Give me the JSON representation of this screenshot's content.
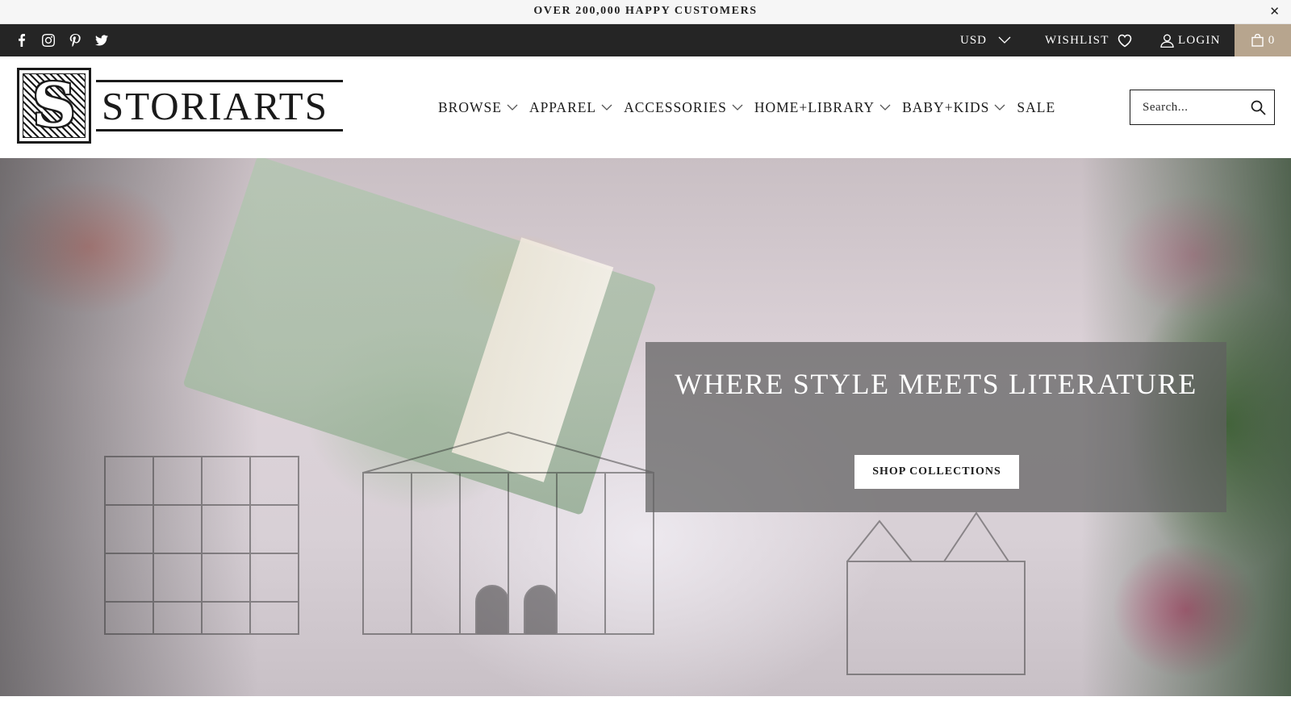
{
  "announcement": {
    "text": "OVER 200,000 HAPPY CUSTOMERS",
    "close_glyph": "✕"
  },
  "topbar": {
    "social": [
      {
        "name": "facebook-icon"
      },
      {
        "name": "instagram-icon"
      },
      {
        "name": "pinterest-icon"
      },
      {
        "name": "twitter-icon"
      }
    ],
    "currency": "USD",
    "wishlist_label": "WISHLIST",
    "login_label": "LOGIN",
    "cart_count": "0",
    "cart_color": "#b7a58e"
  },
  "header": {
    "logo_letter": "S",
    "logo_text": "STORIARTS",
    "nav": [
      {
        "label": "BROWSE",
        "has_dropdown": true
      },
      {
        "label": "APPAREL",
        "has_dropdown": true
      },
      {
        "label": "ACCESSORIES",
        "has_dropdown": true
      },
      {
        "label": "HOME+LIBRARY",
        "has_dropdown": true
      },
      {
        "label": "BABY+KIDS",
        "has_dropdown": true
      },
      {
        "label": "SALE",
        "has_dropdown": false
      }
    ],
    "search_placeholder": "Search..."
  },
  "hero": {
    "title": "WHERE STYLE MEETS LITERATURE",
    "button_label": "SHOP COLLECTIONS"
  }
}
